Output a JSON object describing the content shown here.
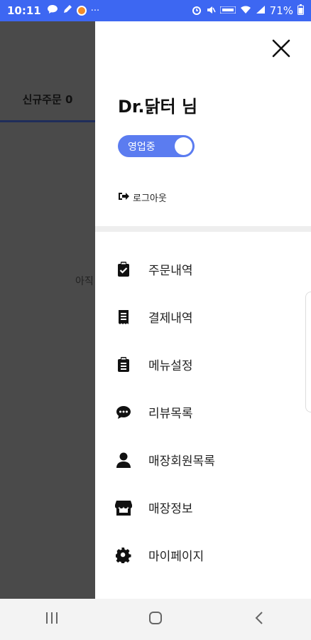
{
  "status_bar": {
    "time": "10:11",
    "left_icons": [
      "chat-bubble-icon",
      "pen-icon",
      "orange-circle-icon",
      "more-dots-icon"
    ],
    "more": "···",
    "battery": "71%",
    "right_icons": [
      "alarm-icon",
      "mute-icon",
      "volte-icon",
      "wifi-icon",
      "signal-icon",
      "battery-icon"
    ]
  },
  "background_app": {
    "tab_label": "신규주문 0",
    "body_text": "아직"
  },
  "drawer": {
    "store_name": "Dr.닭터 님",
    "status_toggle": {
      "label": "영업중",
      "on": true,
      "color": "#5b7cf0"
    },
    "logout_label": "로그아웃",
    "menu": [
      {
        "icon": "clipboard-check-icon",
        "label": "주문내역"
      },
      {
        "icon": "receipt-icon",
        "label": "결제내역"
      },
      {
        "icon": "clipboard-list-icon",
        "label": "메뉴설정"
      },
      {
        "icon": "comment-dots-icon",
        "label": "리뷰목록"
      },
      {
        "icon": "user-icon",
        "label": "매장회원목록"
      },
      {
        "icon": "store-icon",
        "label": "매장정보"
      },
      {
        "icon": "gear-icon",
        "label": "마이페이지"
      }
    ]
  },
  "nav_bar": {
    "buttons": [
      "recent-apps-icon",
      "home-icon",
      "back-icon"
    ]
  },
  "colors": {
    "status_bar": "#3d67f2",
    "accent": "#5b7cf0",
    "overlay": "#4a4a4a"
  }
}
